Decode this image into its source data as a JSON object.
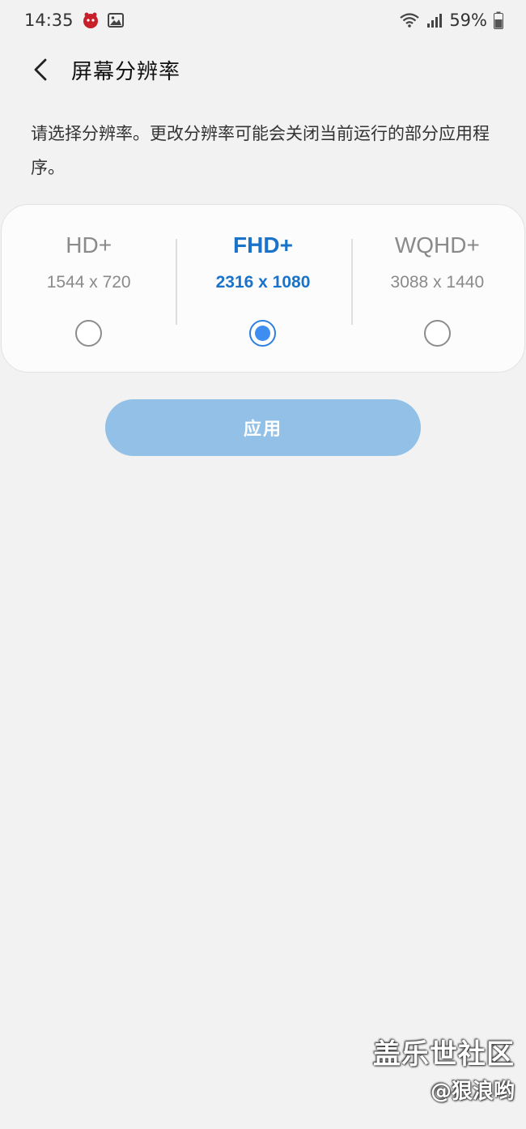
{
  "status_bar": {
    "time": "14:35",
    "battery_percent": "59%",
    "icons": [
      "antutu-icon",
      "gallery-icon",
      "wifi-icon",
      "signal-icon",
      "battery-icon"
    ]
  },
  "header": {
    "title": "屏幕分辨率"
  },
  "description": "请选择分辨率。更改分辨率可能会关闭当前运行的部分应用程序。",
  "resolutions": [
    {
      "name": "HD+",
      "value": "1544 x 720",
      "selected": false
    },
    {
      "name": "FHD+",
      "value": "2316 x 1080",
      "selected": true
    },
    {
      "name": "WQHD+",
      "value": "3088 x 1440",
      "selected": false
    }
  ],
  "apply_button": {
    "label": "应用"
  },
  "watermark": {
    "line1": "盖乐世社区",
    "line2": "@狠浪哟"
  },
  "colors": {
    "background": "#f2f2f2",
    "accent": "#1a73c8",
    "radio_selected": "#3d8ef0",
    "apply_button": "#92c0e6"
  }
}
